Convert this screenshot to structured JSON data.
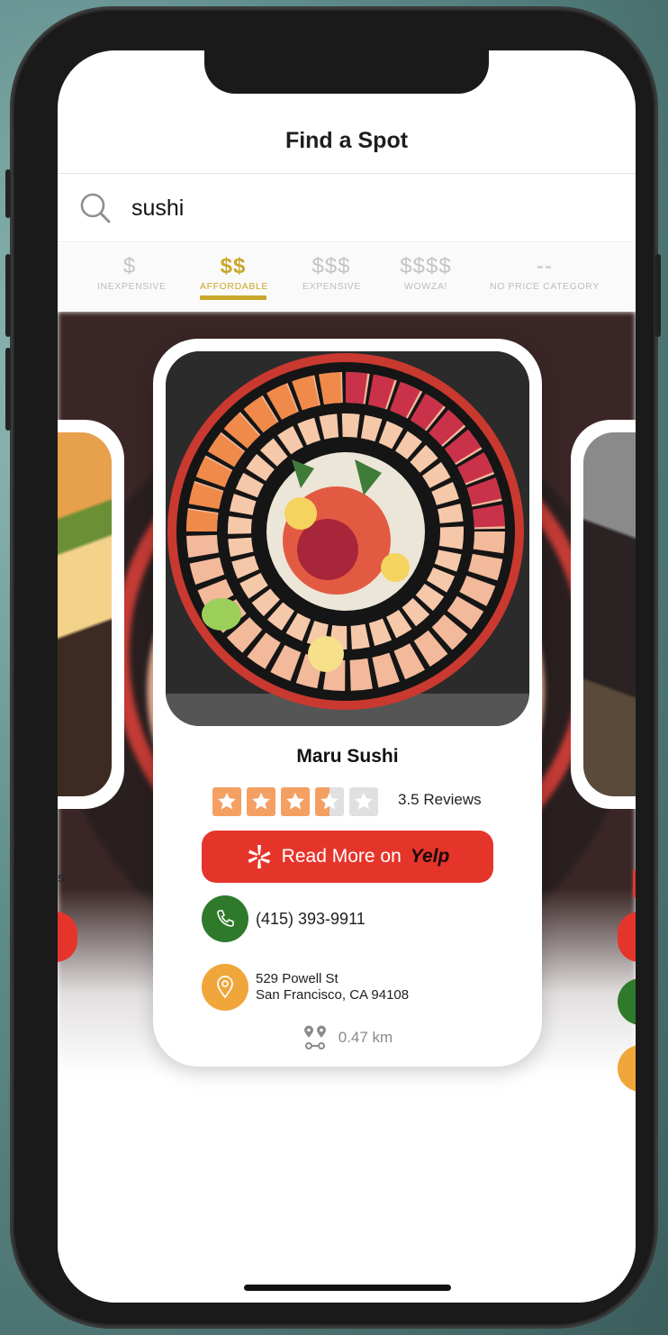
{
  "header": {
    "title": "Find a Spot"
  },
  "search": {
    "value": "sushi"
  },
  "price_filters": [
    {
      "symbol": "$",
      "label": "INEXPENSIVE",
      "active": false
    },
    {
      "symbol": "$$",
      "label": "AFFORDABLE",
      "active": true
    },
    {
      "symbol": "$$$",
      "label": "EXPENSIVE",
      "active": false
    },
    {
      "symbol": "$$$$",
      "label": "WOWZA!",
      "active": false
    },
    {
      "symbol": "--",
      "label": "NO PRICE CATEGORY",
      "active": false
    }
  ],
  "card": {
    "name": "Maru Sushi",
    "rating": 3.5,
    "rating_max": 5,
    "rating_text": "3.5 Reviews",
    "yelp_button": {
      "prefix": "Read More on",
      "brand": "Yelp"
    },
    "phone": "(415) 393-9911",
    "address_line1": "529 Powell St",
    "address_line2": "San Francisco, CA 94108",
    "distance": "0.47 km"
  },
  "peek_left": {
    "partial_text": "s"
  },
  "colors": {
    "accent_gold": "#c9a72c",
    "yelp_red": "#e5352b",
    "phone_green": "#2e7a2a",
    "location_orange": "#f0a63a",
    "star_orange": "#f4a063"
  },
  "icons": {
    "search": "search-icon",
    "yelp": "yelp-burst-icon",
    "phone": "phone-icon",
    "location": "location-pin-icon",
    "distance": "route-pins-icon"
  }
}
